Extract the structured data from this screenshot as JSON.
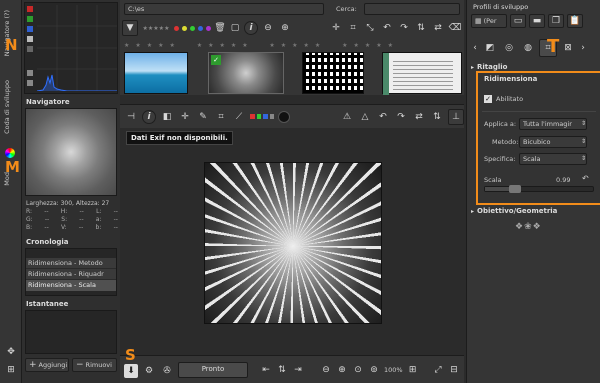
{
  "left_vtabs": {
    "tab1": "Navigatore (?)",
    "tab2": "Coda di sviluppo",
    "tab3": "Mod"
  },
  "left_marks": {
    "n": "N",
    "m": "M",
    "s": "S"
  },
  "navigator": {
    "title": "Navigatore",
    "size_line": "Larghezza: 300, Altezza: 27",
    "rows": [
      [
        "R:",
        "--",
        "H:",
        "--",
        "L:",
        "--"
      ],
      [
        "G:",
        "--",
        "S:",
        "--",
        "a:",
        "--"
      ],
      [
        "B:",
        "--",
        "V:",
        "--",
        "b:",
        "--"
      ]
    ]
  },
  "history": {
    "title": "Cronologia",
    "items": [
      "Ridimensiona - Metodo",
      "Ridimensiona - Riquadr",
      "Ridimensiona - Scala"
    ]
  },
  "snapshots": {
    "title": "Istantanee",
    "add_label": "Aggiungi",
    "remove_label": "Rimuovi"
  },
  "filebrowser": {
    "path": "C:\\es",
    "search_label": "Cerca:"
  },
  "preview": {
    "exif_message": "Dati Exif non disponibili."
  },
  "bottom": {
    "status": "Pronto",
    "zoom": "100%"
  },
  "right": {
    "profile_title": "Profili di sviluppo",
    "profile_value": "(Per",
    "sections": {
      "crop": "Ritaglio",
      "resize": "Ridimensiona",
      "lens": "Obiettivo/Geometria"
    },
    "resize": {
      "enabled_label": "Abilitato",
      "apply_label": "Applica a:",
      "apply_value": "Tutta l'immagir",
      "method_label": "Metodo:",
      "method_value": "Bicubico",
      "spec_label": "Specifica:",
      "spec_value": "Scala",
      "scale_label": "Scala",
      "scale_value": "0.99",
      "scale_fraction": 0.25
    },
    "mark_t": "T"
  },
  "colors": {
    "accent": "#f28c1a",
    "hist": "#2f6fff"
  }
}
